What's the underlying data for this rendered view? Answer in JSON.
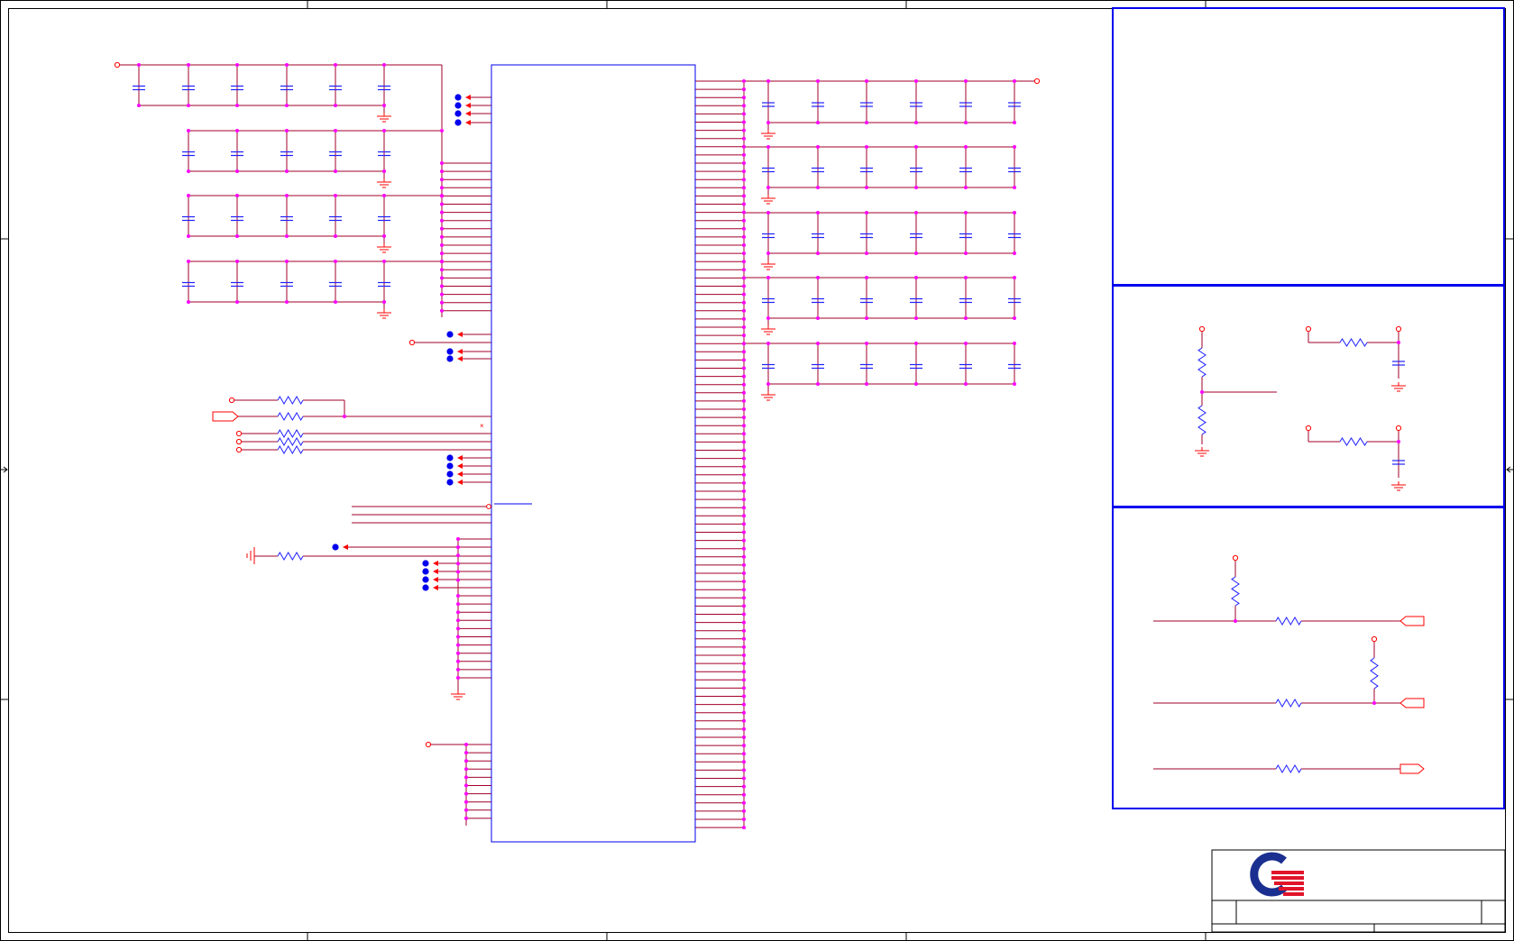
{
  "schematic": {
    "colors": {
      "wire": "#a0002a",
      "component": "#2020ff",
      "junction": "#ff00ff",
      "port": "#ff0000",
      "box": "#0000ee",
      "frame": "#000000",
      "logo_blue": "#1a2f8f",
      "logo_red": "#e0142a"
    },
    "icons": [
      "capacitor-icon",
      "resistor-icon",
      "ground-icon",
      "power-port-icon",
      "offpage-connector-icon",
      "no-connect-icon",
      "company-logo-icon"
    ]
  }
}
